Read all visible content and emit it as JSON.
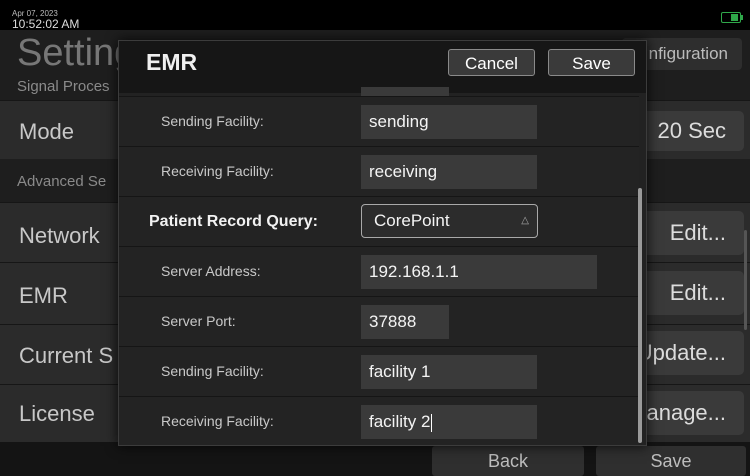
{
  "status": {
    "date": "Apr 07, 2023",
    "time": "10:52:02 AM"
  },
  "background": {
    "title": "Settings",
    "config_button": "nfiguration",
    "signal_section": "Signal Proces",
    "advanced_section": "Advanced Se",
    "rows": [
      {
        "label": "Mode",
        "button": "20 Sec"
      },
      {
        "label": "Network",
        "button": "Edit..."
      },
      {
        "label": "EMR",
        "button": "Edit..."
      },
      {
        "label": "Current S",
        "button": "Update..."
      },
      {
        "label": "License",
        "button": "anage..."
      }
    ],
    "back_button": "Back",
    "save_button": "Save"
  },
  "modal": {
    "title": "EMR",
    "cancel": "Cancel",
    "save": "Save",
    "rows": [
      {
        "label": "Sending Facility:",
        "value": "sending"
      },
      {
        "label": "Receiving Facility:",
        "value": "receiving"
      },
      {
        "label": "Patient Record Query:",
        "value": "CorePoint"
      },
      {
        "label": "Server Address:",
        "value": "192.168.1.1"
      },
      {
        "label": "Server Port:",
        "value": "37888"
      },
      {
        "label": "Sending Facility:",
        "value": "facility 1"
      },
      {
        "label": "Receiving Facility:",
        "value": "facility 2"
      }
    ]
  },
  "colors": {
    "battery": "#2fa84a",
    "modal_header": "#161616",
    "field": "#3a3a3a"
  }
}
